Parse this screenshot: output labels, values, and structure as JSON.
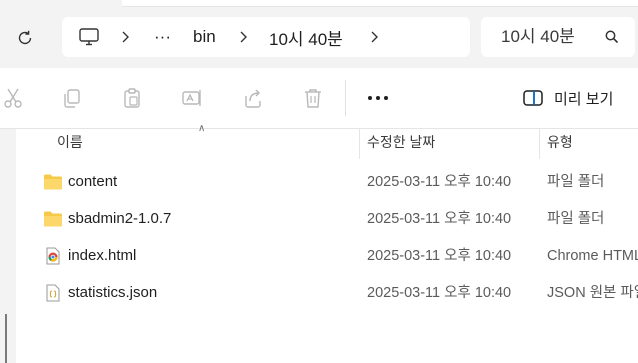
{
  "address": {
    "more_label": "···",
    "crumbs": [
      "bin",
      "10시 40분"
    ]
  },
  "search": {
    "placeholder": "10시 40분"
  },
  "toolbar": {
    "preview_label": "미리 보기"
  },
  "columns": {
    "name": "이름",
    "date": "수정한 날짜",
    "type": "유형"
  },
  "files": [
    {
      "name": "content",
      "date": "2025-03-11 오후 10:40",
      "type": "파일 폴더",
      "icon": "folder-icon"
    },
    {
      "name": "sbadmin2-1.0.7",
      "date": "2025-03-11 오후 10:40",
      "type": "파일 폴더",
      "icon": "folder-icon"
    },
    {
      "name": "index.html",
      "date": "2025-03-11 오후 10:40",
      "type": "Chrome HTML Document",
      "icon": "chrome-html-icon"
    },
    {
      "name": "statistics.json",
      "date": "2025-03-11 오후 10:40",
      "type": "JSON 원본 파일",
      "icon": "json-file-icon"
    }
  ],
  "colors": {
    "folder": "#f7c948",
    "accent": "#0067c0",
    "disabled_icon": "#b8b8b8"
  }
}
